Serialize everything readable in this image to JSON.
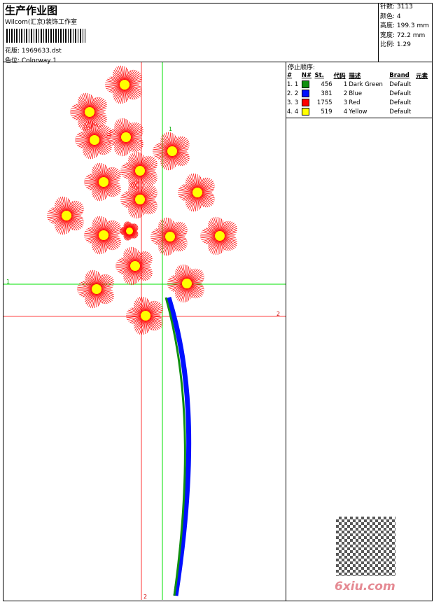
{
  "header": {
    "title": "生产作业图",
    "company": "Wilcom(汇京)装饰工作室",
    "design_file": "花版: 1969633.dst",
    "colorway": "色位: Colorway 1"
  },
  "meta": {
    "stitches": "针数: 3113",
    "colors": "颜色: 4",
    "height": "高度: 199.3 mm",
    "width": "宽度: 72.2 mm",
    "scale": "比例: 1.29"
  },
  "stop_sequence": {
    "label": "停止顺序:",
    "headers": [
      "#",
      "N#",
      "St.",
      "代码",
      "描述",
      "Brand",
      "元素"
    ],
    "rows": [
      {
        "idx": "1.",
        "n": "1",
        "color": "#109010",
        "st": "456",
        "code": "1",
        "desc": "Dark Green",
        "brand": "Default"
      },
      {
        "idx": "2.",
        "n": "2",
        "color": "#0010ff",
        "st": "381",
        "code": "2",
        "desc": "Blue",
        "brand": "Default"
      },
      {
        "idx": "3.",
        "n": "3",
        "color": "#ff0000",
        "st": "1755",
        "code": "3",
        "desc": "Red",
        "brand": "Default"
      },
      {
        "idx": "4.",
        "n": "4",
        "color": "#ffff00",
        "st": "519",
        "code": "4",
        "desc": "Yellow",
        "brand": "Default"
      }
    ]
  },
  "guides": {
    "green_v": "1",
    "green_h": "1",
    "red_h": "2",
    "red_v": "2"
  },
  "watermark": "6xiu.com"
}
